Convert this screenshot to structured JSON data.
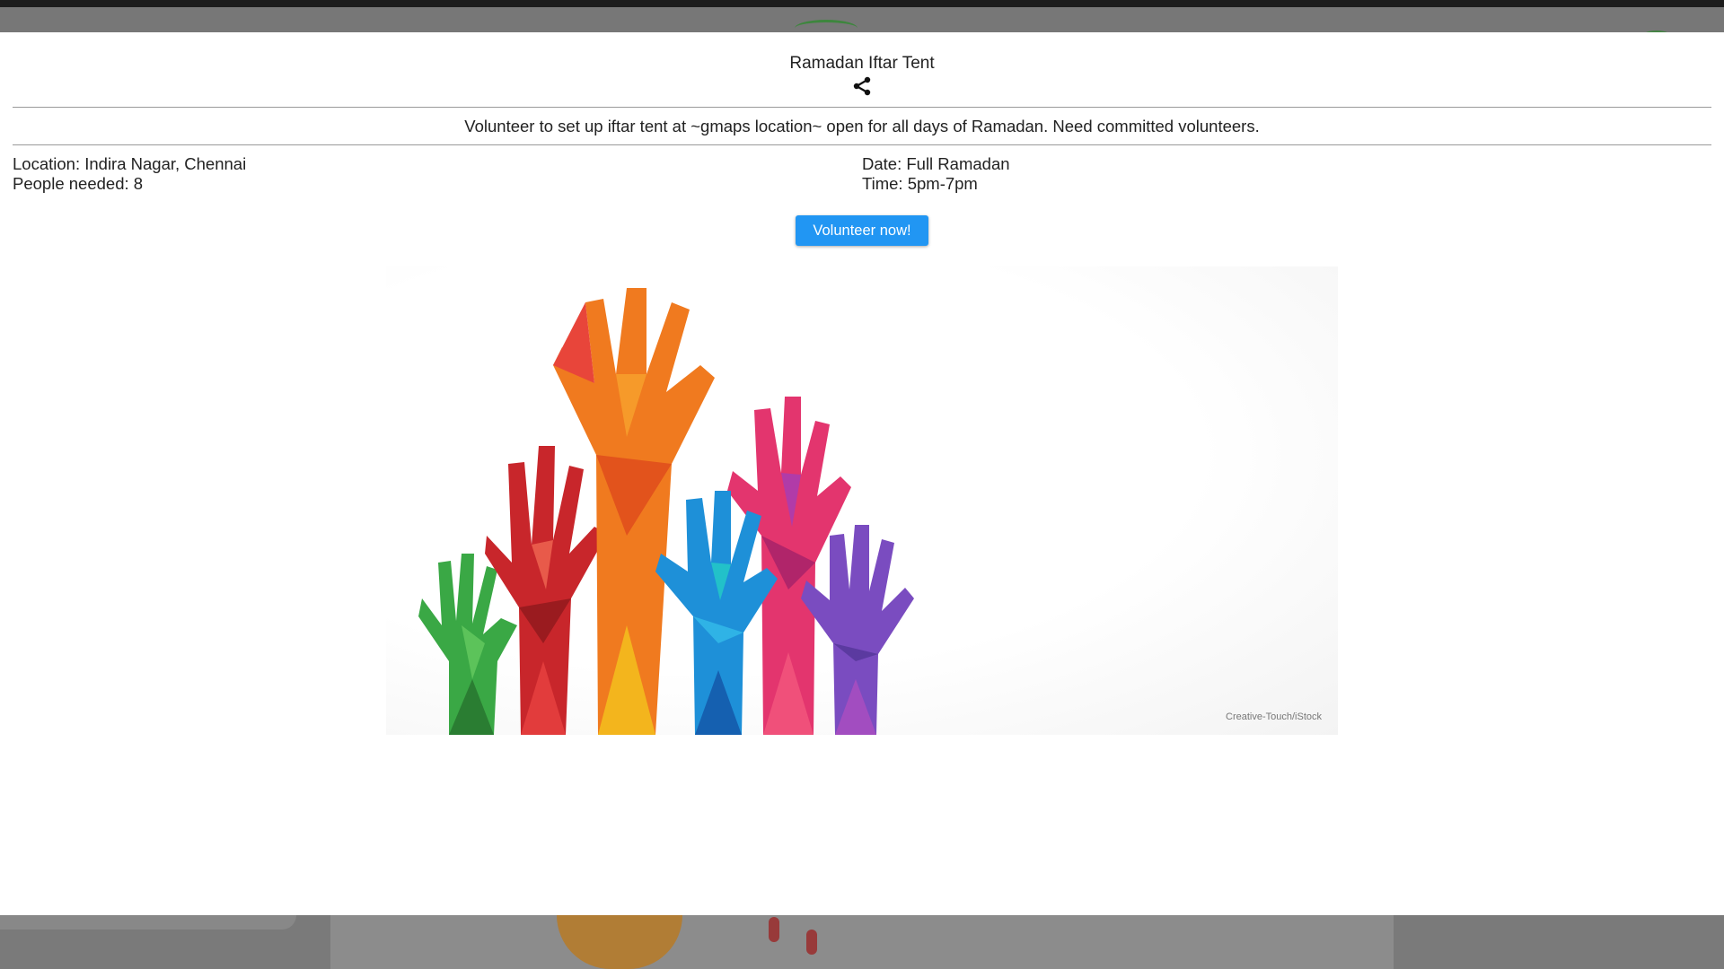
{
  "event": {
    "title": "Ramadan Iftar Tent",
    "description": "Volunteer to set up iftar tent at ~gmaps location~ open for all days of Ramadan. Need committed volunteers.",
    "location": "Location: Indira Nagar, Chennai",
    "people_needed": "People needed: 8",
    "date": "Date: Full Ramadan",
    "time": "Time: 5pm-7pm",
    "cta_label": "Volunteer now!"
  },
  "image": {
    "credit": "Creative-Touch/iStock"
  },
  "icons": {
    "share": "share-icon"
  },
  "colors": {
    "accent": "#2196f3"
  }
}
